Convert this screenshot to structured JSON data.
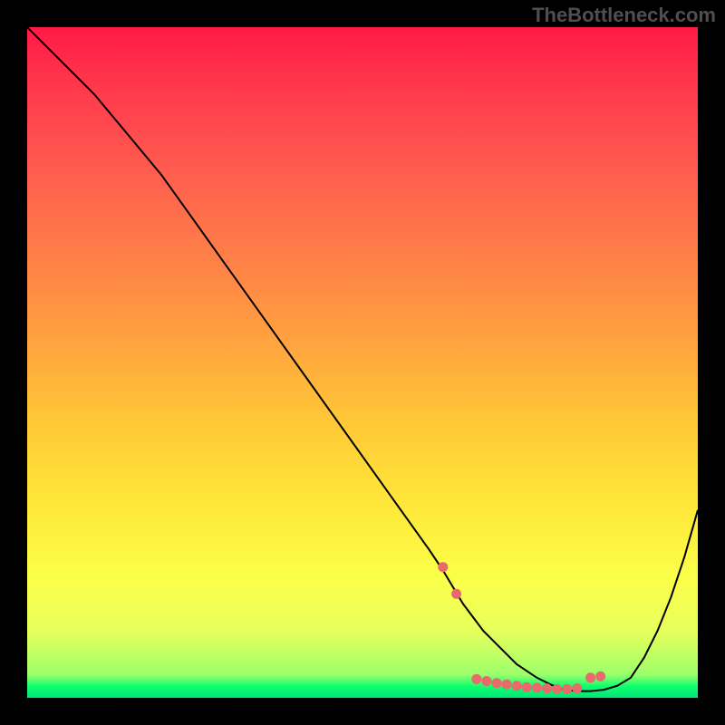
{
  "watermark": "TheBottleneck.com",
  "chart_data": {
    "type": "line",
    "title": "",
    "xlabel": "",
    "ylabel": "",
    "xlim": [
      0,
      100
    ],
    "ylim": [
      0,
      100
    ],
    "series": [
      {
        "name": "bottleneck-curve",
        "x": [
          0,
          5,
          10,
          15,
          20,
          25,
          30,
          35,
          40,
          45,
          50,
          55,
          60,
          62,
          65,
          68,
          70,
          73,
          76,
          78,
          80,
          82,
          84,
          86,
          88,
          90,
          92,
          94,
          96,
          98,
          100
        ],
        "y": [
          100,
          95,
          90,
          84,
          78,
          71,
          64,
          57,
          50,
          43,
          36,
          29,
          22,
          19,
          14,
          10,
          8,
          5,
          3,
          2,
          1.2,
          1.0,
          1.0,
          1.2,
          1.8,
          3,
          6,
          10,
          15,
          21,
          28
        ]
      }
    ],
    "markers": {
      "name": "highlight-dots",
      "color": "#e86a6a",
      "points": [
        {
          "x": 62,
          "y": 19.5
        },
        {
          "x": 64,
          "y": 15.5
        },
        {
          "x": 67,
          "y": 2.8
        },
        {
          "x": 68.5,
          "y": 2.5
        },
        {
          "x": 70,
          "y": 2.2
        },
        {
          "x": 71.5,
          "y": 2.0
        },
        {
          "x": 73,
          "y": 1.8
        },
        {
          "x": 74.5,
          "y": 1.6
        },
        {
          "x": 76,
          "y": 1.5
        },
        {
          "x": 77.5,
          "y": 1.4
        },
        {
          "x": 79,
          "y": 1.3
        },
        {
          "x": 80.5,
          "y": 1.3
        },
        {
          "x": 82,
          "y": 1.4
        },
        {
          "x": 84,
          "y": 3.0
        },
        {
          "x": 85.5,
          "y": 3.2
        }
      ]
    },
    "background_gradient": {
      "top": "#ff1a47",
      "bottom": "#00e676"
    }
  }
}
